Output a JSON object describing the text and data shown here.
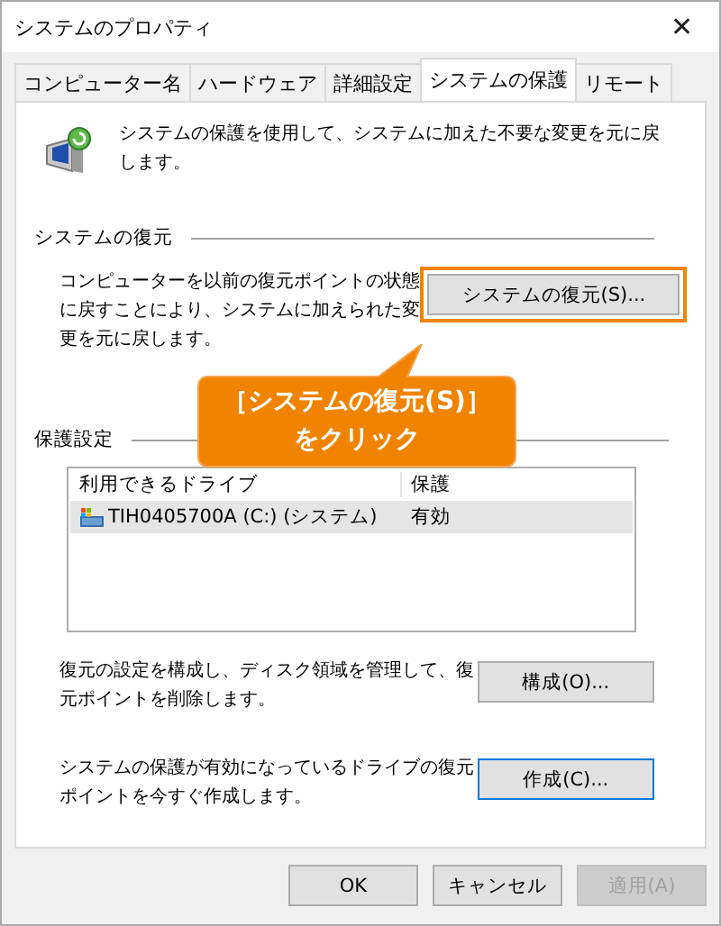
{
  "window": {
    "title": "システムのプロパティ",
    "close": "✕"
  },
  "tabs": [
    {
      "label": "コンピューター名",
      "selected": false
    },
    {
      "label": "ハードウェア",
      "selected": false
    },
    {
      "label": "詳細設定",
      "selected": false
    },
    {
      "label": "システムの保護",
      "selected": true
    },
    {
      "label": "リモート",
      "selected": false
    }
  ],
  "intro": "システムの保護を使用して、システムに加えた不要な変更を元に戻します。",
  "restore_section": {
    "heading": "システムの復元",
    "text": "コンピューターを以前の復元ポイントの状態に戻すことにより、システムに加えられた変更を元に戻します。",
    "button": {
      "label": "システムの復元(S)...",
      "highlighted": true
    }
  },
  "callout": {
    "text": "［システムの復元(S)］をクリック"
  },
  "protection_section": {
    "heading": "保護設定",
    "table": {
      "columns": [
        "利用できるドライブ",
        "保護"
      ],
      "rows": [
        {
          "drive": "TIH0405700A (C:) (システム)",
          "protection": "有効",
          "selected": true
        }
      ]
    }
  },
  "configure": {
    "text": "復元の設定を構成し、ディスク領域を管理して、復元ポイントを削除します。",
    "button": {
      "label": "構成(O)...",
      "focused": false
    }
  },
  "create": {
    "text": "システムの保護が有効になっているドライブの復元ポイントを今すぐ作成します。",
    "button": {
      "label": "作成(C)...",
      "focused": true
    }
  },
  "buttons": [
    {
      "label": "OK",
      "disabled": false
    },
    {
      "label": "キャンセル",
      "disabled": false
    },
    {
      "label": "適用(A)",
      "disabled": true
    }
  ]
}
